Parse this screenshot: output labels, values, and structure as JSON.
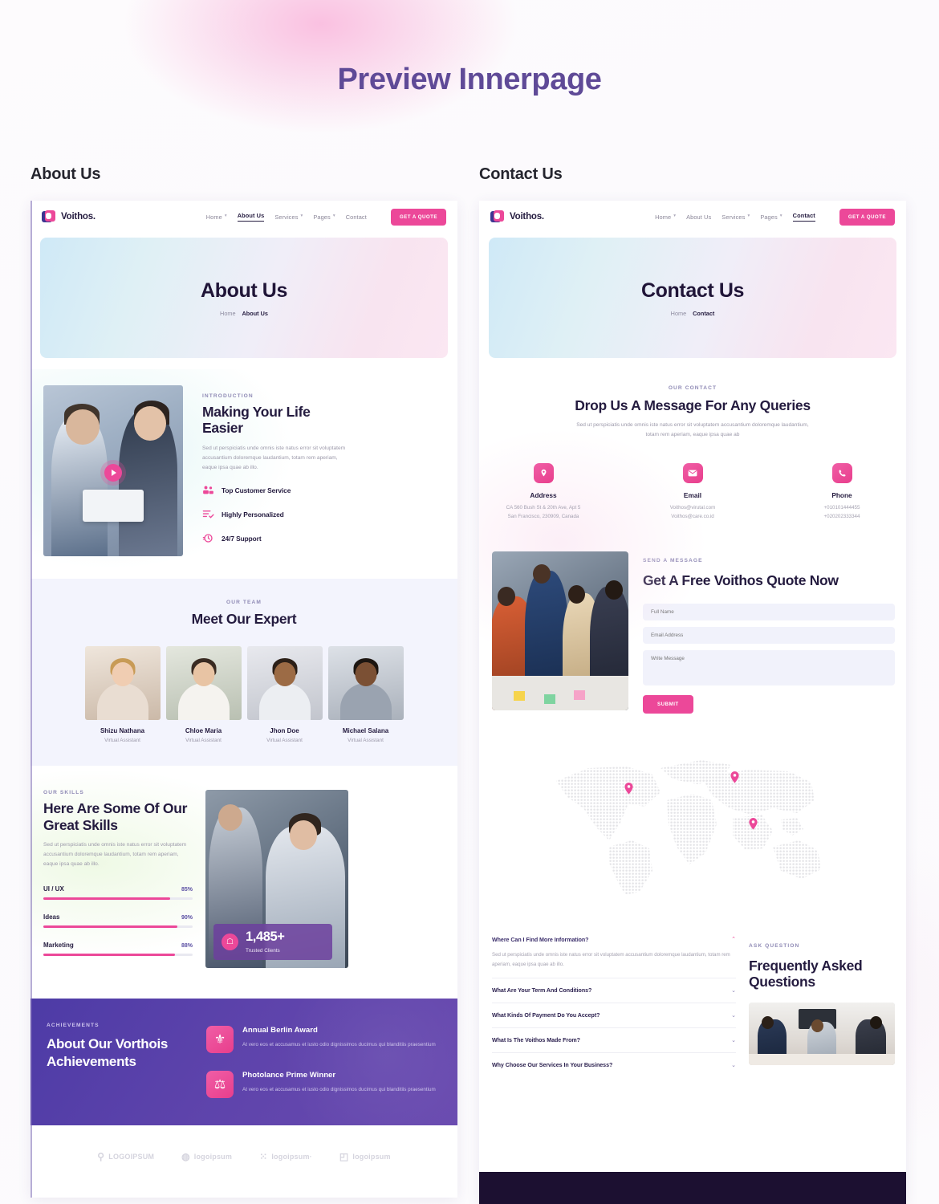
{
  "page": {
    "title": "Preview Innerpage"
  },
  "columns": {
    "about_label": "About Us",
    "contact_label": "Contact Us"
  },
  "brand": {
    "name": "Voithos."
  },
  "nav": {
    "items": [
      {
        "label": "Home",
        "caret": "▾"
      },
      {
        "label": "About Us",
        "caret": ""
      },
      {
        "label": "Services",
        "caret": "▾"
      },
      {
        "label": "Pages",
        "caret": "▾"
      },
      {
        "label": "Contact",
        "caret": ""
      }
    ],
    "cta": "GET A QUOTE"
  },
  "about": {
    "hero": {
      "title": "About Us",
      "crumb_home": "Home",
      "crumb_current": "About Us"
    },
    "intro": {
      "eyebrow": "INTRODUCTION",
      "heading": "Making Your Life Easier",
      "body": "Sed ut perspiciatis unde omnis iste natus error sit voluptatem accusantium doloremque laudantium, totam rem aperiam, eaque ipsa quae ab illo.",
      "features": [
        {
          "label": "Top Customer Service",
          "icon": "users-icon"
        },
        {
          "label": "Highly Personalized",
          "icon": "list-check-icon"
        },
        {
          "label": "24/7 Support",
          "icon": "clock-icon"
        }
      ],
      "play": "play-icon"
    },
    "team": {
      "eyebrow": "OUR TEAM",
      "heading": "Meet Our Expert",
      "members": [
        {
          "name": "Shizu Nathana",
          "role": "Virtual Assistant",
          "bg": "#e4d7cd",
          "hair": "#c89b56",
          "skin": "#f0cdb2",
          "torso": "#e9ddd2"
        },
        {
          "name": "Chloe Maria",
          "role": "Virtual Assistant",
          "bg": "#d9ddd4",
          "hair": "#3a2b22",
          "skin": "#e8c4a4",
          "torso": "#f5f3ef"
        },
        {
          "name": "Jhon Doe",
          "role": "Virtual Assistant",
          "bg": "#dcdde2",
          "hair": "#2c2018",
          "skin": "#9c6b45",
          "torso": "#eceef2"
        },
        {
          "name": "Michael Salana",
          "role": "Virtual Assistant",
          "bg": "#cfd4db",
          "hair": "#1d1611",
          "skin": "#7b5034",
          "torso": "#9aa3b0"
        }
      ]
    },
    "skills": {
      "eyebrow": "OUR SKILLS",
      "heading": "Here Are Some Of Our Great Skills",
      "body": "Sed ut perspiciatis unde omnis iste natus error sit voluptatem accusantium doloremque laudantium, totam rem aperiam, eaque ipsa quae ab illo.",
      "bars": [
        {
          "label": "UI / UX",
          "value": "85%",
          "pct": 85
        },
        {
          "label": "Ideas",
          "value": "90%",
          "pct": 90
        },
        {
          "label": "Marketing",
          "value": "88%",
          "pct": 88
        }
      ],
      "clients": {
        "number": "1,485+",
        "caption": "Trusted Clients",
        "icon": "badge-icon"
      }
    },
    "achievements": {
      "eyebrow": "ACHIEVEMENTS",
      "heading": "About Our Vorthois Achievements",
      "items": [
        {
          "title": "Annual Berlin Award",
          "desc": "At vero eos et accusamus et iusto odio dignissimos ducimus qui blanditiis praesentium",
          "icon": "award-seal-icon"
        },
        {
          "title": "Photolance Prime Winner",
          "desc": "At vero eos et accusamus et iusto odio dignissimos ducimus qui blanditiis praesentium",
          "icon": "award-badge-icon"
        }
      ]
    },
    "logos": [
      {
        "text": "LOGOIPSUM",
        "glyph": "⚲"
      },
      {
        "text": "logoipsum",
        "glyph": "◍"
      },
      {
        "text": "logoipsum·",
        "glyph": "⁙"
      },
      {
        "text": "logoipsum",
        "glyph": "◰"
      }
    ]
  },
  "contact": {
    "hero": {
      "title": "Contact Us",
      "crumb_home": "Home",
      "crumb_current": "Contact"
    },
    "head": {
      "eyebrow": "OUR CONTACT",
      "heading": "Drop Us A Message For Any Queries",
      "body": "Sed ut perspiciatis unde omnis iste natus error sit voluptatem accusantium doloremque laudantium, totam rem aperiam, eaque ipsa quae ab"
    },
    "info": [
      {
        "title": "Address",
        "icon": "location-pin-icon",
        "glyph": "⚲",
        "line1": "CA 560 Bush St & 20th Ave, Apt 5",
        "line2": "San Francisco, 230909, Canada"
      },
      {
        "title": "Email",
        "icon": "envelope-icon",
        "glyph": "✉",
        "line1": "Voithos@virutal.com",
        "line2": "Voithos@care.co.id"
      },
      {
        "title": "Phone",
        "icon": "phone-icon",
        "glyph": "✆",
        "line1": "+010101444455",
        "line2": "+020202333344"
      }
    ],
    "form": {
      "eyebrow": "SEND A MESSAGE",
      "heading": "Get A Free Voithos Quote Now",
      "fields": [
        {
          "name": "full-name",
          "placeholder": "Full Name"
        },
        {
          "name": "email-address",
          "placeholder": "Email Address"
        },
        {
          "name": "write-message",
          "placeholder": "Write Message"
        }
      ],
      "submit": "SUBMIT"
    },
    "map": {
      "pins": 3
    },
    "faq": {
      "eyebrow": "ASK QUESTION",
      "heading": "Frequently Asked Questions",
      "items": [
        {
          "q": "Where Can I Find More Information?",
          "open": true,
          "chevron": "⌃",
          "a": "Sed ut perspiciatis unde omnis iste natus error sit voluptatem accusantium doloremque laudantium, totam rem aperiam, eaque ipsa quae ab illo."
        },
        {
          "q": "What Are Your Term And Conditions?",
          "open": false,
          "chevron": "⌄",
          "a": ""
        },
        {
          "q": "What Kinds Of Payment Do You Accept?",
          "open": false,
          "chevron": "⌄",
          "a": ""
        },
        {
          "q": "What Is The Voithos Made From?",
          "open": false,
          "chevron": "⌄",
          "a": ""
        },
        {
          "q": "Why Choose Our Services In Your Business?",
          "open": false,
          "chevron": "⌄",
          "a": ""
        }
      ]
    }
  },
  "colors": {
    "accent_pink": "#ec4899",
    "deep_purple": "#241b3f",
    "title_purple": "#5f4a97",
    "achv_bg": "#5d43ab",
    "team_bg": "#f3f4fd"
  }
}
